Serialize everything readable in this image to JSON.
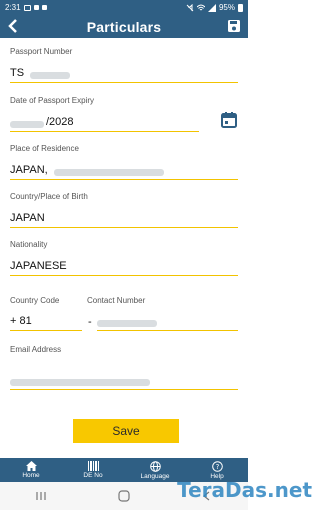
{
  "status_bar": {
    "time": "2:31",
    "battery": "95%"
  },
  "appbar": {
    "title": "Particulars"
  },
  "form": {
    "passport_number": {
      "label": "Passport Number",
      "value_visible": "TS"
    },
    "passport_expiry": {
      "label": "Date of Passport Expiry",
      "value_visible": "/2028"
    },
    "place_of_residence": {
      "label": "Place of Residence",
      "value_visible": "JAPAN,"
    },
    "country_of_birth": {
      "label": "Country/Place of Birth",
      "value": "JAPAN"
    },
    "nationality": {
      "label": "Nationality",
      "value": "JAPANESE"
    },
    "country_code": {
      "label": "Country Code",
      "value": "+ 81"
    },
    "contact_number": {
      "label": "Contact Number",
      "value_prefix": "-"
    },
    "email": {
      "label": "Email Address"
    }
  },
  "save_button": {
    "label": "Save"
  },
  "bottom_nav": [
    {
      "label": "Home",
      "icon": "home-icon"
    },
    {
      "label": "DE No",
      "icon": "barcode-icon"
    },
    {
      "label": "Language",
      "icon": "globe-icon"
    },
    {
      "label": "Help",
      "icon": "help-icon"
    }
  ],
  "watermark": "TeraDas.net",
  "colors": {
    "primary": "#2f5f84",
    "accent": "#f8c800",
    "underline": "#f2c300"
  }
}
